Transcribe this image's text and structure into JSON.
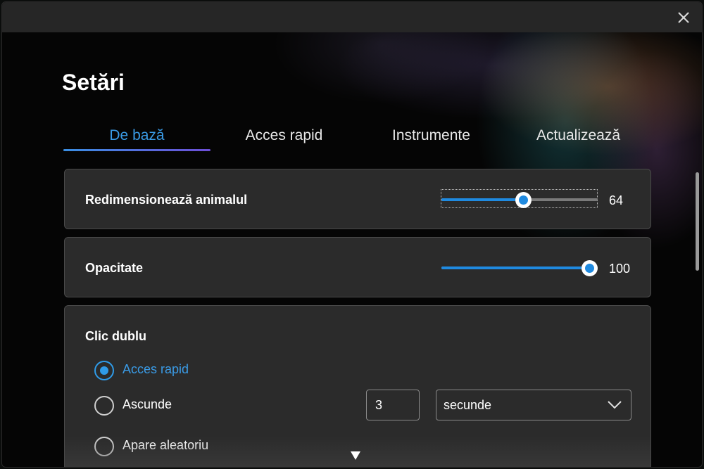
{
  "window": {
    "close_icon": "close-icon"
  },
  "page": {
    "title": "Setări"
  },
  "tabs": [
    {
      "label": "De bază",
      "active": true
    },
    {
      "label": "Acces rapid",
      "active": false
    },
    {
      "label": "Instrumente",
      "active": false
    },
    {
      "label": "Actualizează",
      "active": false
    }
  ],
  "settings": {
    "resize": {
      "label": "Redimensionează animalul",
      "value": "64",
      "fraction": 0.53
    },
    "opacity": {
      "label": "Opacitate",
      "value": "100",
      "fraction": 1.0
    },
    "double_click": {
      "label": "Clic dublu",
      "options": [
        {
          "label": "Acces rapid",
          "checked": true
        },
        {
          "label": "Ascunde",
          "checked": false
        },
        {
          "label": "Apare aleatoriu",
          "checked": false
        }
      ],
      "seconds_value": "3",
      "unit_selected": "secunde"
    }
  },
  "colors": {
    "accent": "#1f8ae0",
    "accent_text": "#3a9be6",
    "card_bg": "#2b2b2b",
    "titlebar_bg": "#262626"
  }
}
